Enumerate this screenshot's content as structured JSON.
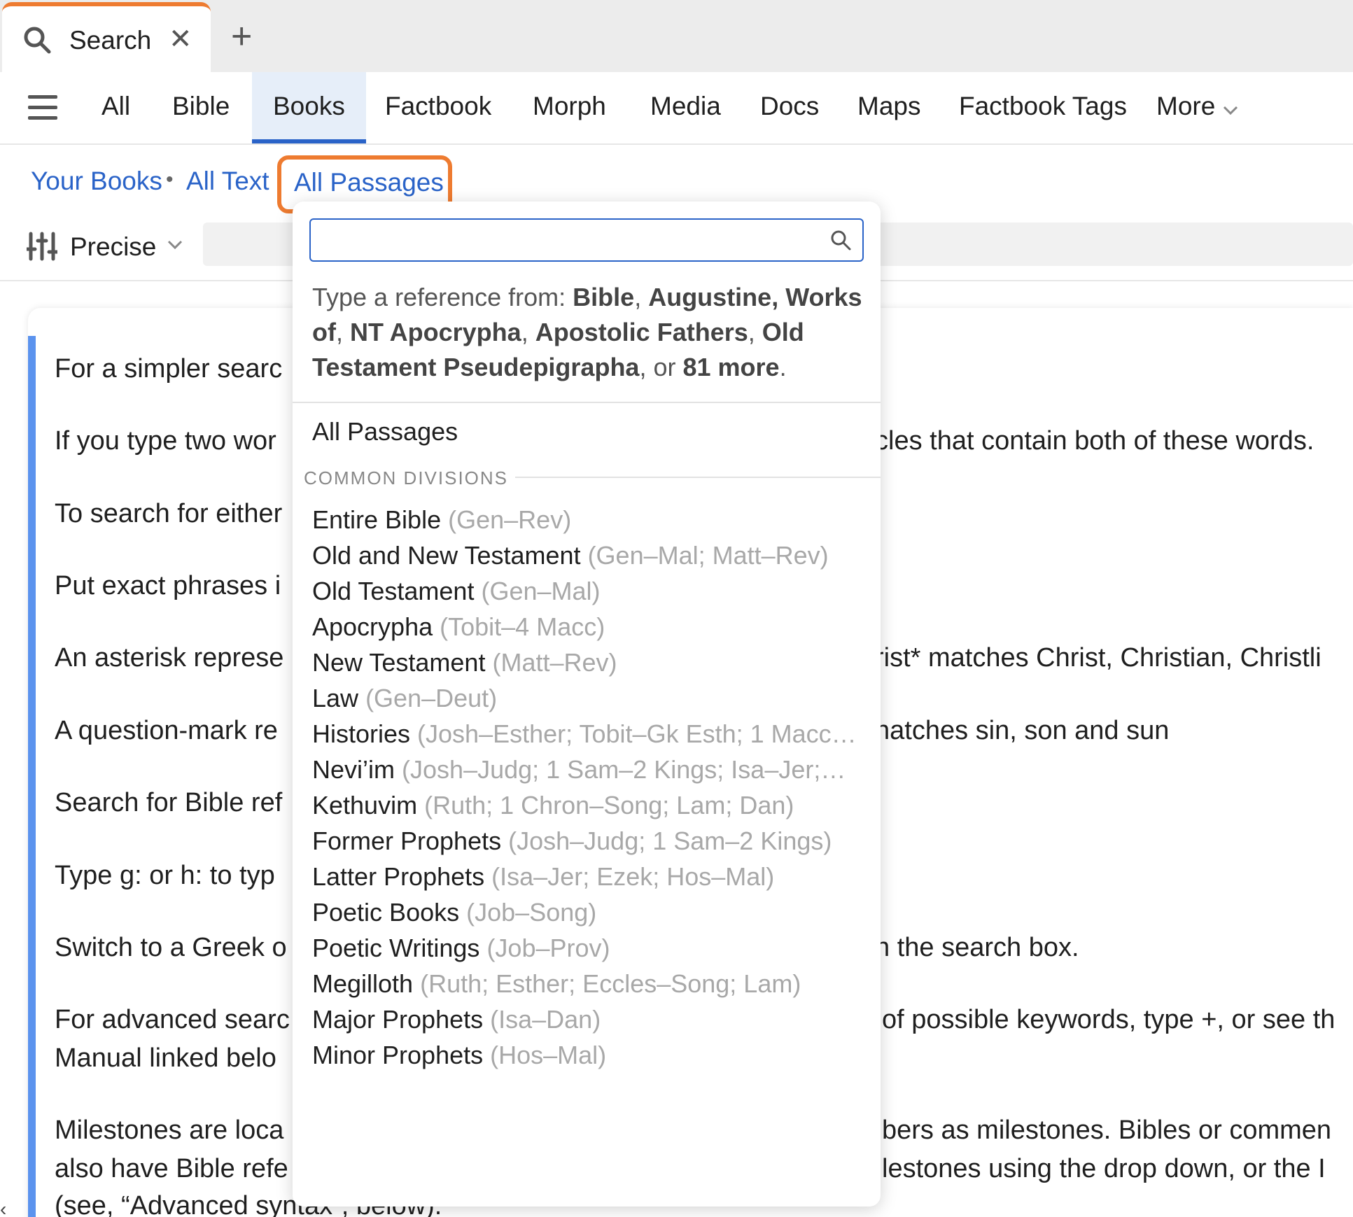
{
  "tab": {
    "title": "Search",
    "close_glyph": "✕",
    "new_tab_glyph": "+"
  },
  "nav": {
    "items": [
      "All",
      "Bible",
      "Books",
      "Factbook",
      "Morph",
      "Media",
      "Docs",
      "Maps",
      "Factbook Tags",
      "More"
    ],
    "active": "Books"
  },
  "breadcrumb": {
    "your_books": "Your Books",
    "separator": "•",
    "all_text": "All Text",
    "all_passages": "All Passages"
  },
  "search_row": {
    "mode": "Precise"
  },
  "help": {
    "lines_left": [
      "For a simpler searc",
      "If you type two wor",
      "To search for either",
      "Put exact phrases i",
      "An asterisk represe",
      "A question-mark re",
      "Search for Bible ref",
      "Type g: or h: to typ",
      "Switch to a Greek o",
      "For advanced searc",
      "Manual linked belo",
      "Milestones are loca",
      "also have Bible refe",
      "(see, “Advanced syntax”, below)."
    ],
    "lines_right": [
      "cles that contain both of these words.",
      "rist* matches Christ, Christian, Christli",
      "natches sin, son and sun",
      "n the search box.",
      "of possible keywords, type +, or see th",
      "bers as milestones. Bibles or commen",
      "lestones using the drop down, or the I"
    ]
  },
  "dropdown": {
    "search_value": "",
    "hint_prefix": "Type a reference from: ",
    "hint_sources": [
      "Bible",
      "Augustine, Works of",
      "NT Apocrypha",
      "Apostolic Fathers",
      "Old Testament Pseudepigrapha"
    ],
    "hint_more": "81 more",
    "all_passages": "All Passages",
    "section_title": "COMMON DIVISIONS",
    "items": [
      {
        "name": "Entire Bible",
        "range": "(Gen–Rev)"
      },
      {
        "name": "Old and New Testament",
        "range": "(Gen–Mal; Matt–Rev)"
      },
      {
        "name": "Old Testament",
        "range": "(Gen–Mal)"
      },
      {
        "name": "Apocrypha",
        "range": "(Tobit–4 Macc)"
      },
      {
        "name": "New Testament",
        "range": "(Matt–Rev)"
      },
      {
        "name": "Law",
        "range": "(Gen–Deut)"
      },
      {
        "name": "Histories",
        "range": "(Josh–Esther; Tobit–Gk Esth; 1 Macc…"
      },
      {
        "name": "Nevi’im",
        "range": "(Josh–Judg; 1 Sam–2 Kings; Isa–Jer;…"
      },
      {
        "name": "Kethuvim",
        "range": "(Ruth; 1 Chron–Song; Lam; Dan)"
      },
      {
        "name": "Former Prophets",
        "range": "(Josh–Judg; 1 Sam–2 Kings)"
      },
      {
        "name": "Latter Prophets",
        "range": "(Isa–Jer; Ezek; Hos–Mal)"
      },
      {
        "name": "Poetic Books",
        "range": "(Job–Song)"
      },
      {
        "name": "Poetic Writings",
        "range": "(Job–Prov)"
      },
      {
        "name": "Megilloth",
        "range": "(Ruth; Esther; Eccles–Song; Lam)"
      },
      {
        "name": "Major Prophets",
        "range": "(Isa–Dan)"
      },
      {
        "name": "Minor Prophets",
        "range": "(Hos–Mal)"
      }
    ]
  },
  "colors": {
    "accent_orange": "#ee7b30",
    "link_blue": "#2a63c8",
    "rule_blue": "#5b93ee"
  },
  "icons": [
    "search-icon",
    "close-icon",
    "plus-icon",
    "hamburger-icon",
    "chevron-down-icon",
    "sliders-icon"
  ]
}
